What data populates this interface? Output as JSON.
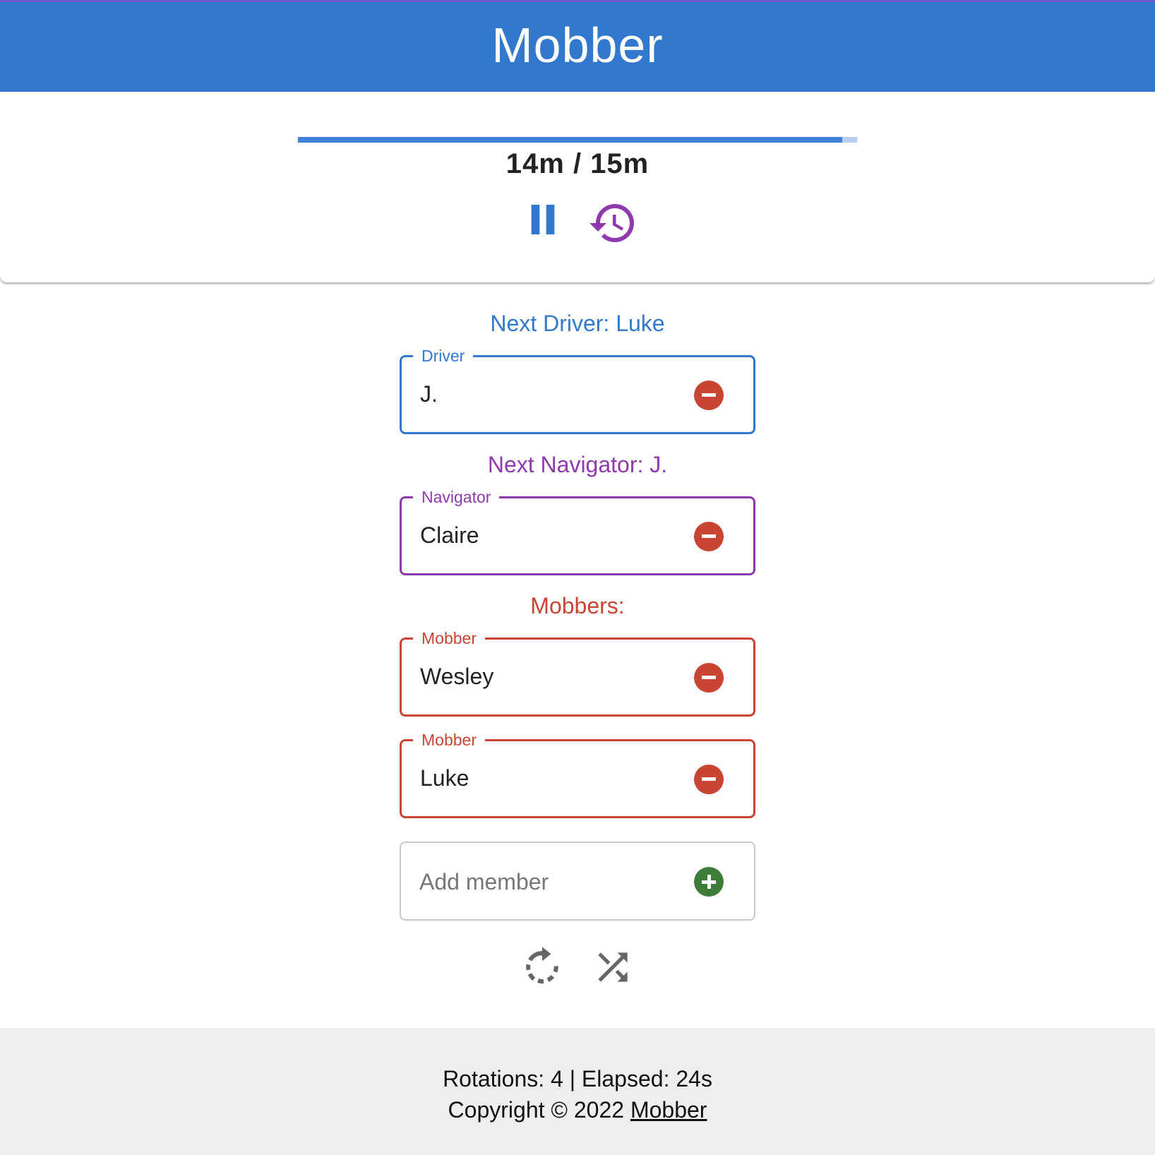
{
  "app": {
    "title": "Mobber"
  },
  "timer": {
    "progress_fraction": 0.973,
    "time_text": "14m / 15m",
    "pause_icon": "pause-icon",
    "history_icon": "restart-history-icon"
  },
  "roles": {
    "next_driver": "Next Driver: Luke",
    "driver": {
      "legend": "Driver",
      "value": "J."
    },
    "next_navigator": "Next Navigator: J.",
    "navigator": {
      "legend": "Navigator",
      "value": "Claire"
    },
    "mobbers_heading": "Mobbers:",
    "mobbers": [
      {
        "legend": "Mobber",
        "value": "Wesley"
      },
      {
        "legend": "Mobber",
        "value": "Luke"
      }
    ]
  },
  "add_member": {
    "placeholder": "Add member"
  },
  "actions": {
    "rotate_icon": "rotate-icon",
    "shuffle_icon": "shuffle-icon"
  },
  "footer": {
    "stats": "Rotations: 4 | Elapsed: 24s",
    "copyright": "Copyright © 2022 ",
    "link": "Mobber"
  },
  "colors": {
    "primary": "#3378cf",
    "navigator": "#8e3aae",
    "mobber": "#c94432",
    "remove": "#c94432",
    "add": "#3d7d39"
  }
}
